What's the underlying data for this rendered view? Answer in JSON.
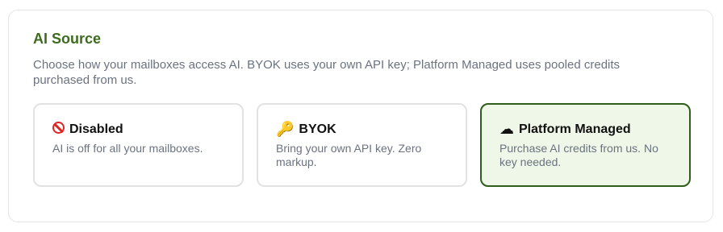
{
  "ai_source": {
    "title": "AI Source",
    "description": "Choose how your mailboxes access AI. BYOK uses your own API key; Platform Managed uses pooled credits purchased from us.",
    "selected": "platform_managed",
    "options": [
      {
        "id": "disabled",
        "icon": "prohibited-icon",
        "title": "Disabled",
        "text": "AI is off for all your mailboxes."
      },
      {
        "id": "byok",
        "icon": "key-icon",
        "icon_glyph": "🔑",
        "title": "BYOK",
        "text": "Bring your own API key. Zero markup."
      },
      {
        "id": "platform_managed",
        "icon": "cloud-icon",
        "icon_glyph": "☁",
        "title": "Platform Managed",
        "text": "Purchase AI credits from us. No key needed."
      }
    ]
  },
  "colors": {
    "title": "#3d6b1f",
    "selected_border": "#2f5d1a",
    "selected_background": "#eef7e8",
    "muted_text": "#6b7280"
  }
}
